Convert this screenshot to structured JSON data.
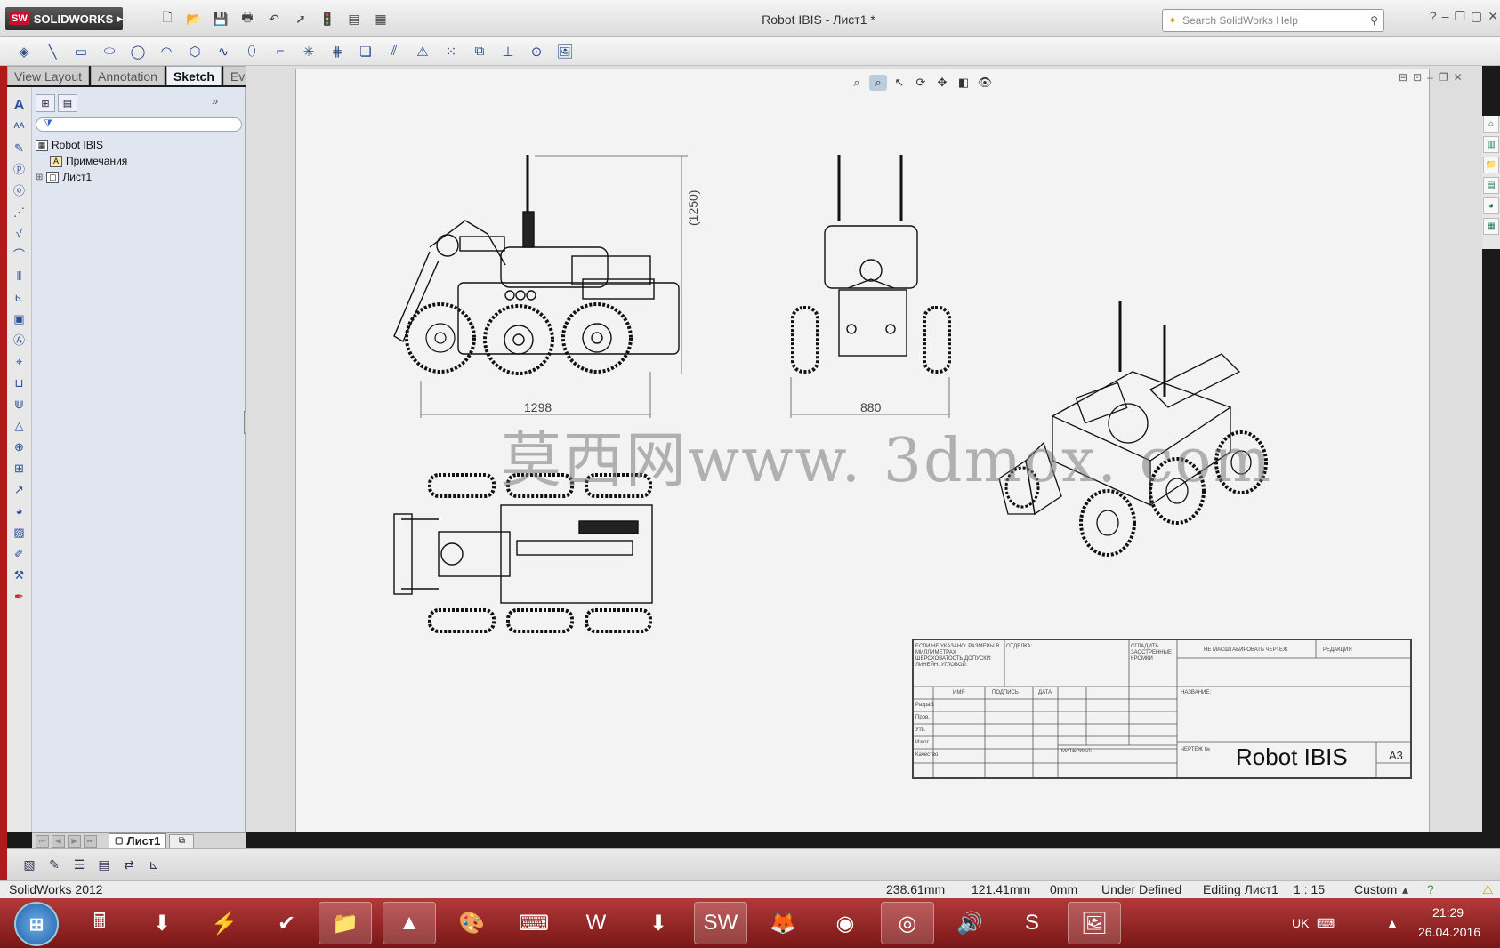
{
  "app": {
    "brand": "SOLIDWORKS",
    "window_title": "Robot IBIS - Лист1 *",
    "search_placeholder": "Search SolidWorks Help",
    "version_label": "SolidWorks 2012"
  },
  "command_tabs": [
    "View Layout",
    "Annotation",
    "Sketch",
    "Evaluate"
  ],
  "active_tab": "Sketch",
  "feature_tree": {
    "root": "Robot IBIS",
    "items": [
      "Примечания",
      "Лист1"
    ]
  },
  "sheet_tab": "Лист1",
  "drawing": {
    "dim_height": "(1250)",
    "dim_length": "1298",
    "dim_width": "880",
    "watermark": "莫西网www. 3dmox. com",
    "title_block": {
      "title": "Robot IBIS",
      "size": "A3",
      "fields": [
        "ЕСЛИ НЕ УКАЗАНО: РАЗМЕРЫ В МИЛЛИМЕТРАХ ШЕРОХОВАТОСТЬ ДОПУСКИ: ЛИНЕЙН: УГЛОВОЙ:",
        "ОТДЕЛКА:",
        "СГЛАДИТЬ ЗАОСТРЕННЫЕ КРОМКИ",
        "НЕ МАСШТАБИРОВАТЬ ЧЕРТЕЖ",
        "РЕДАКЦИЯ",
        "ИМЯ",
        "ПОДПИСЬ",
        "ДАТА",
        "НАЗВАНИЕ:",
        "Разраб.",
        "Пров.",
        "Утв.",
        "Изгот.",
        "Качество",
        "МАТЕРИАЛ:",
        "ЧЕРТЕЖ №"
      ]
    }
  },
  "status": {
    "x": "238.61mm",
    "y": "121.41mm",
    "z": "0mm",
    "state": "Under Defined",
    "editing": "Editing Лист1",
    "scale": "1 : 15",
    "units": "Custom"
  },
  "tray": {
    "lang": "UK",
    "time": "21:29",
    "date": "26.04.2016"
  },
  "taskbar_apps": [
    "Calculator",
    "Download",
    "Winamp",
    "Norton",
    "Explorer",
    "VLC",
    "Paint",
    "On-screen keyboard",
    "Word",
    "Downloader",
    "SolidWorks",
    "Firefox",
    "NVIDIA",
    "Chrome",
    "Volume",
    "Skype",
    "Image viewer"
  ],
  "colors": {
    "accent": "#c8102e",
    "taskbar": "#9a2424"
  }
}
